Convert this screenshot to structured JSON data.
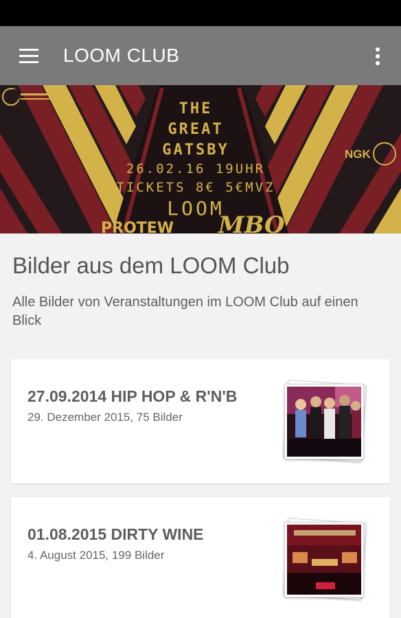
{
  "app_bar": {
    "title": "LOOM CLUB",
    "menu_icon": "hamburger-menu-icon",
    "overflow_icon": "more-vert-icon",
    "background_color": "#7a7a7a"
  },
  "banner": {
    "line1": "THE",
    "line2": "GREAT",
    "line3": "GATSBY",
    "line4": "26.02.16 19UHR",
    "line5": "TICKETS 8€ 5€MVZ",
    "line6": "LOOM",
    "line7": "PROTEW",
    "line8": "MBO",
    "logo_right": "NGK",
    "colors": {
      "background": "#24191a",
      "red": "#7a1f26",
      "gold": "#d4b24a"
    }
  },
  "page": {
    "title": "Bilder aus dem LOOM Club",
    "subtitle": "Alle Bilder von Veranstaltungen im LOOM Club auf einen Blick"
  },
  "albums": [
    {
      "title": "27.09.2014 HIP HOP & R'N'B",
      "meta": "29. Dezember 2015, 75 Bilder"
    },
    {
      "title": "01.08.2015 DIRTY WINE",
      "meta": "4. August 2015, 199 Bilder"
    }
  ]
}
